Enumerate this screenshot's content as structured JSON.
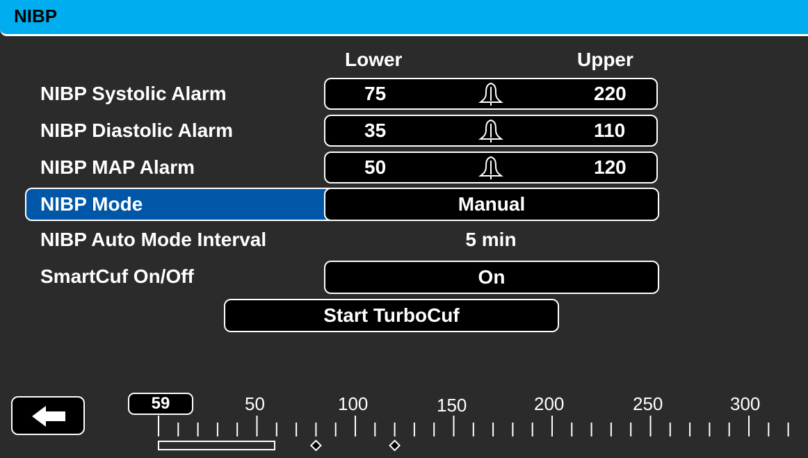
{
  "title": "NIBP",
  "columns": {
    "lower": "Lower",
    "upper": "Upper"
  },
  "alarms": [
    {
      "label": "NIBP Systolic Alarm",
      "lower": "75",
      "upper": "220"
    },
    {
      "label": "NIBP Diastolic Alarm",
      "lower": "35",
      "upper": "110"
    },
    {
      "label": "NIBP MAP Alarm",
      "lower": "50",
      "upper": "120"
    }
  ],
  "mode": {
    "label": "NIBP Mode",
    "value": "Manual"
  },
  "auto_interval": {
    "label": "NIBP Auto Mode Interval",
    "value": "5 min"
  },
  "smartcuf": {
    "label": "SmartCuf On/Off",
    "value": "On"
  },
  "turbocuf_button": "Start TurboCuf",
  "slider": {
    "current_value": "59",
    "tick_labels": [
      "50",
      "100",
      "150",
      "200",
      "250",
      "300"
    ],
    "range": [
      0,
      320
    ],
    "marker_values": [
      80,
      120
    ]
  },
  "icons": {
    "back": "back-arrow-icon",
    "alarm": "bell-icon"
  },
  "colors": {
    "header": "#00aeef",
    "selected": "#0057a8",
    "background": "#2b2b2b"
  }
}
